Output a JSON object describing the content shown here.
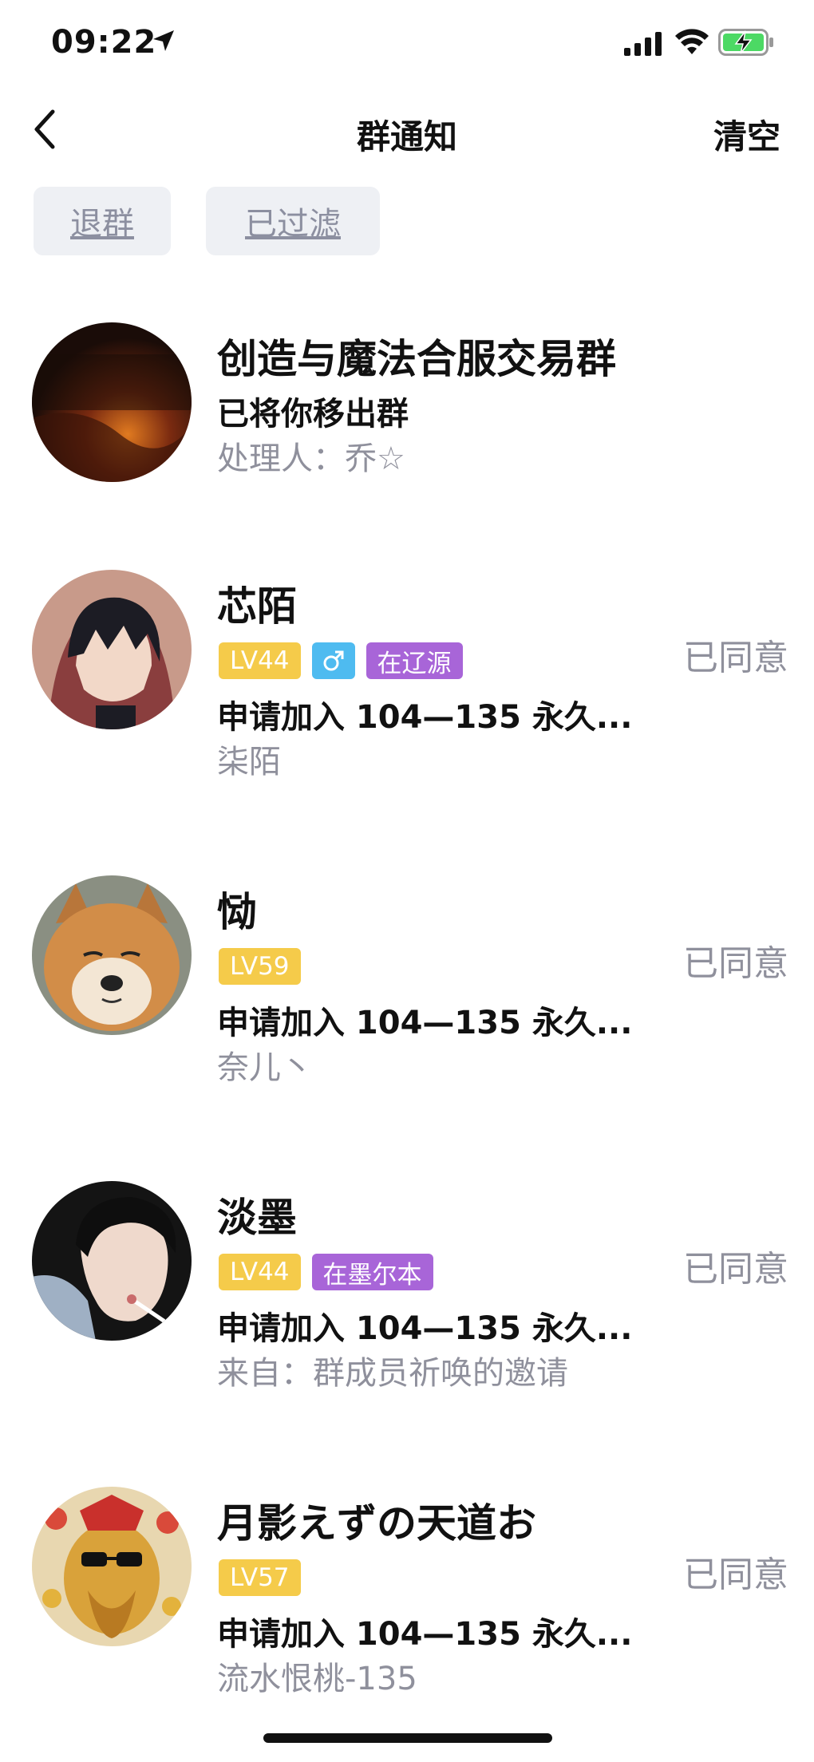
{
  "status_bar": {
    "time": "09:22",
    "battery_color": "#4cd964"
  },
  "nav": {
    "title": "群通知",
    "clear_label": "清空",
    "back_icon": "chevron-left-icon"
  },
  "filters": {
    "quit_label": "退群",
    "filtered_label": "已过滤"
  },
  "items": [
    {
      "name": "创造与魔法合服交易群",
      "desc": "已将你移出群",
      "sub": "处理人：乔☆",
      "status": ""
    },
    {
      "name": "芯陌",
      "level": "LV44",
      "gender_icon": "male-icon",
      "location": "在辽源",
      "desc": "申请加入 104—135 永久...",
      "sub": "柒陌",
      "status": "已同意"
    },
    {
      "name": "恸",
      "level": "LV59",
      "desc": "申请加入 104—135 永久...",
      "sub": "奈儿丶",
      "status": "已同意"
    },
    {
      "name": "淡墨",
      "level": "LV44",
      "location": "在墨尔本",
      "desc": "申请加入 104—135 永久...",
      "sub": "来自：群成员祈唤的邀请",
      "status": "已同意"
    },
    {
      "name": "月影えずの天道お",
      "level": "LV57",
      "desc": "申请加入 104—135 永久...",
      "sub": "流水恨桃-135",
      "status": "已同意"
    }
  ],
  "colors": {
    "level_badge": "#f5cb4a",
    "gender_badge": "#4ebbf0",
    "location_badge": "#a865d8",
    "status_text": "#8f909c"
  }
}
